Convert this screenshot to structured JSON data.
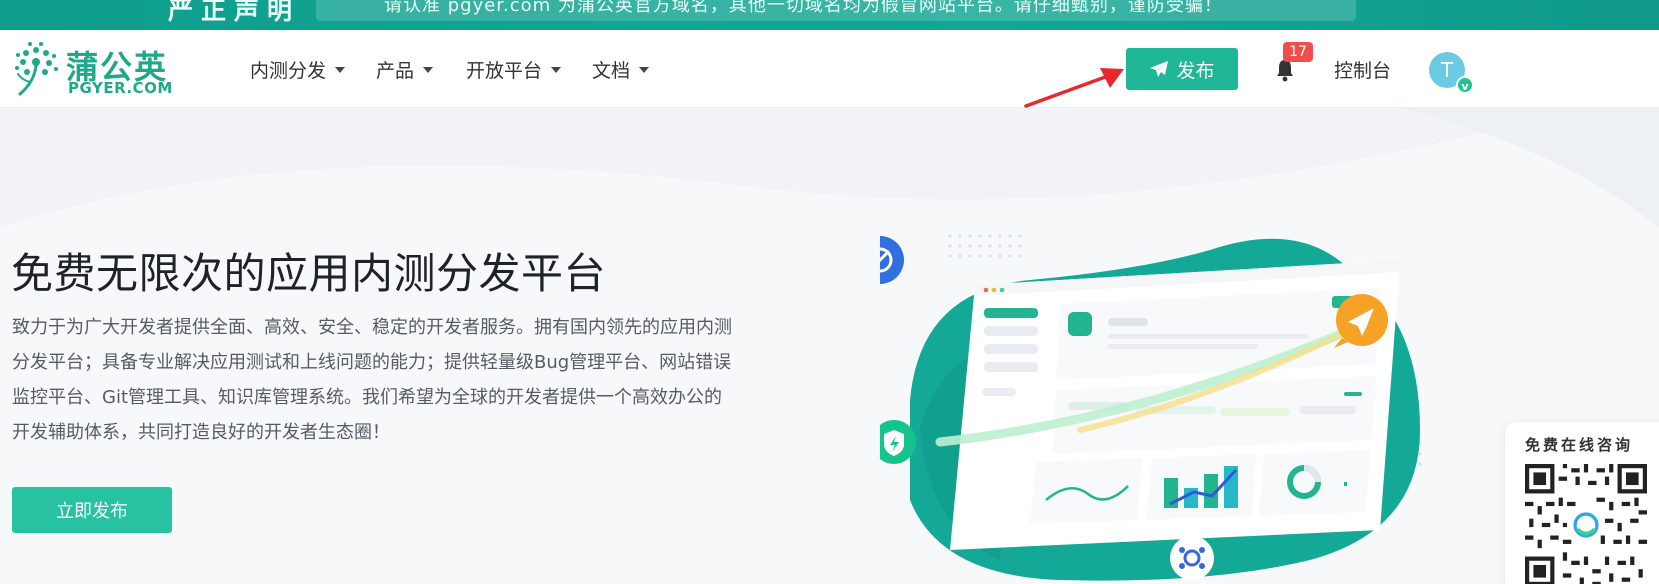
{
  "banner": {
    "title": "严正声明",
    "text": "请认准 pgyer.com 为蒲公英官方域名，其他一切域名均为假冒网站平台。请仔细甄别，谨防受骗！"
  },
  "logo": {
    "cn": "蒲公英",
    "en": "PGYER.COM"
  },
  "nav": {
    "items": [
      "内测分发",
      "产品",
      "开放平台",
      "文档"
    ],
    "publish_label": "发布",
    "badge_count": "17",
    "console_label": "控制台",
    "avatar_letter": "T",
    "avatar_verified": "v"
  },
  "hero": {
    "title": "免费无限次的应用内测分发平台",
    "description": "致力于为广大开发者提供全面、高效、安全、稳定的开发者服务。拥有国内领先的应用内测分发平台；具备专业解决应用测试和上线问题的能力；提供轻量级Bug管理平台、网站错误监控平台、Git管理工具、知识库管理系统。我们希望为全球的开发者提供一个高效办公的开发辅助体系，共同打造良好的开发者生态圈！",
    "cta_label": "立即发布"
  },
  "consult": {
    "title": "免费在线咨询"
  },
  "colors": {
    "brand": "#1fb796",
    "accent": "#28c2a3",
    "badge": "#f04d4d",
    "arrow": "#e8282b"
  }
}
